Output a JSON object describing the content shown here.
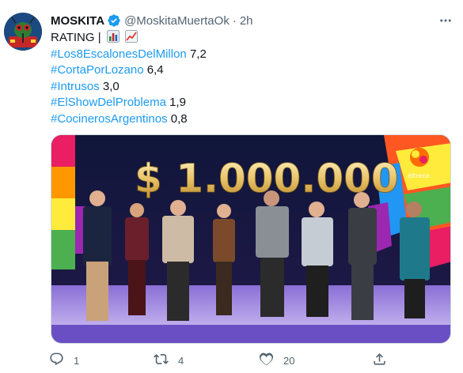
{
  "tweet": {
    "display_name": "MOSKITA",
    "handle": "@MoskitaMuertaOk",
    "separator": "·",
    "time": "2h",
    "first_line": "RATING |",
    "ratings": [
      {
        "tag": "#Los8EscalonesDelMillon",
        "value": "7,2"
      },
      {
        "tag": "#CortaPorLozano",
        "value": "6,4"
      },
      {
        "tag": "#Intrusos",
        "value": "3,0"
      },
      {
        "tag": "#ElShowDelProblema",
        "value": "1,9"
      },
      {
        "tag": "#CocinerosArgentinos",
        "value": "0,8"
      }
    ],
    "media": {
      "banner_text": "$ 1.000.000",
      "channel_logo_text": "eltrece"
    },
    "actions": {
      "reply_count": "1",
      "retweet_count": "4",
      "like_count": "20"
    }
  },
  "icons": {
    "verified": "verified-badge-icon",
    "more": "more-options-icon",
    "reply": "reply-icon",
    "retweet": "retweet-icon",
    "like": "like-icon",
    "share": "share-icon",
    "bar_chart_emoji": "bar-chart-emoji-icon",
    "chart_up_emoji": "chart-increasing-emoji-icon"
  },
  "colors": {
    "text": "#0f1419",
    "secondary": "#536471",
    "link": "#1d9bf0"
  }
}
